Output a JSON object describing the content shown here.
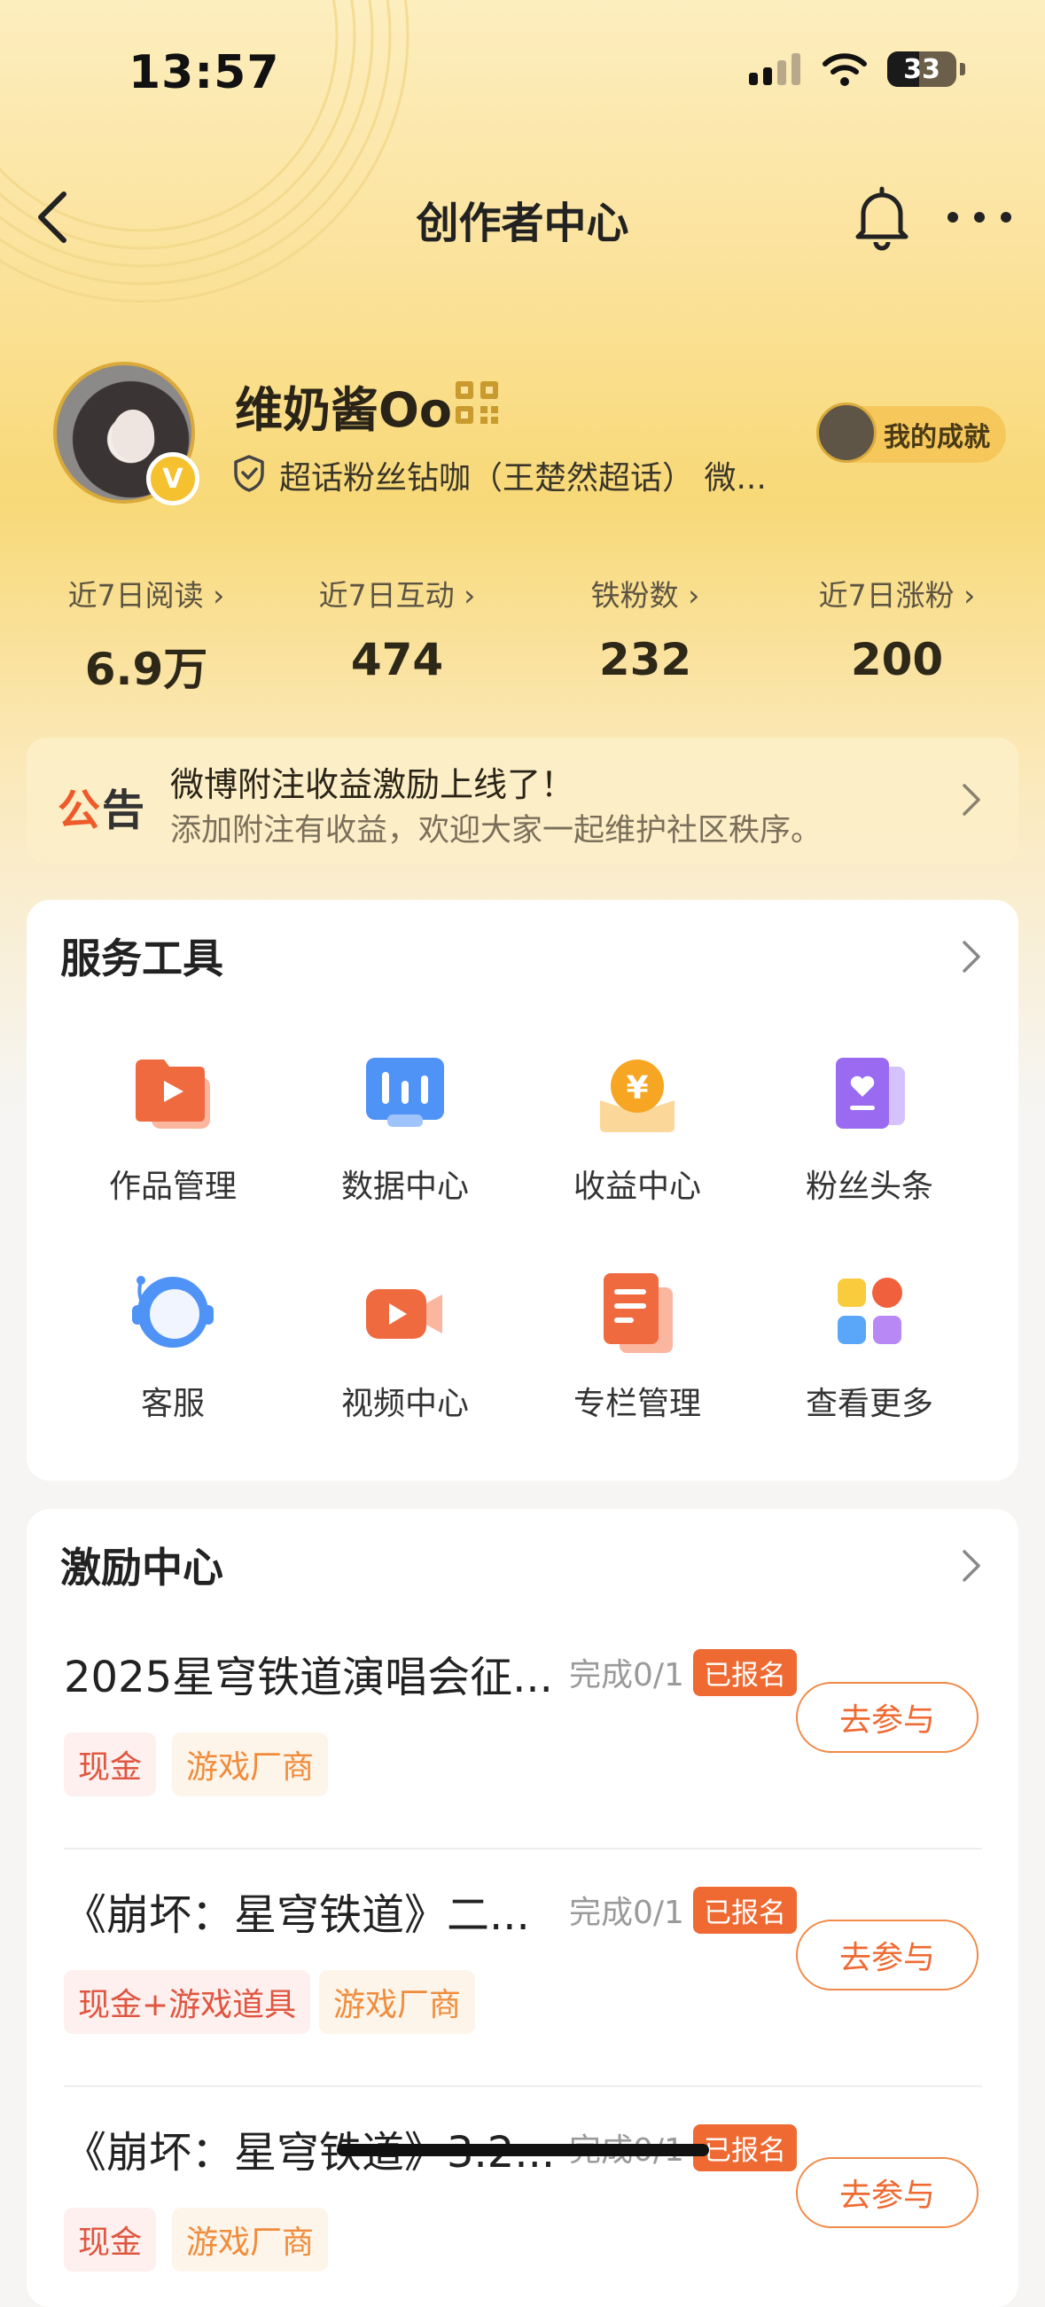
{
  "status_bar": {
    "time": "13:57",
    "battery": "33"
  },
  "nav": {
    "title": "创作者中心"
  },
  "profile": {
    "username": "维奶酱Oo",
    "subtitle": "超话粉丝钻咖（王楚然超话） 微...",
    "achievement_label": "我的成就"
  },
  "stats": [
    {
      "label": "近7日阅读",
      "value": "6.9万"
    },
    {
      "label": "近7日互动",
      "value": "474"
    },
    {
      "label": "铁粉数",
      "value": "232"
    },
    {
      "label": "近7日涨粉",
      "value": "200"
    }
  ],
  "notice": {
    "tag_part1": "公",
    "tag_part2": "告",
    "title": "微博附注收益激励上线了！",
    "subtitle": "添加附注有收益，欢迎大家一起维护社区秩序。"
  },
  "services": {
    "title": "服务工具",
    "items": [
      {
        "label": "作品管理",
        "icon": "works-management-icon"
      },
      {
        "label": "数据中心",
        "icon": "data-center-icon"
      },
      {
        "label": "收益中心",
        "icon": "revenue-center-icon"
      },
      {
        "label": "粉丝头条",
        "icon": "fan-headline-icon"
      },
      {
        "label": "客服",
        "icon": "customer-service-icon"
      },
      {
        "label": "视频中心",
        "icon": "video-center-icon"
      },
      {
        "label": "专栏管理",
        "icon": "column-management-icon"
      },
      {
        "label": "查看更多",
        "icon": "more-apps-icon"
      }
    ]
  },
  "incentives": {
    "title": "激励中心",
    "items": [
      {
        "title": "2025星穹铁道演唱会征...",
        "progress": "完成0/1",
        "status": "已报名",
        "tags": [
          "现金",
          "游戏厂商"
        ],
        "action": "去参与"
      },
      {
        "title": "《崩坏：星穹铁道》二...",
        "progress": "完成0/1",
        "status": "已报名",
        "tags": [
          "现金+游戏道具",
          "游戏厂商"
        ],
        "action": "去参与"
      },
      {
        "title": "《崩坏：星穹铁道》3.2...",
        "progress": "完成0/1",
        "status": "已报名",
        "tags": [
          "现金",
          "游戏厂商"
        ],
        "action": "去参与"
      }
    ]
  },
  "colors": {
    "accent": "#ef6a32",
    "header_gold": "#f8d978",
    "tag_red": "#e0553f",
    "tag_orange": "#f08c3c"
  }
}
